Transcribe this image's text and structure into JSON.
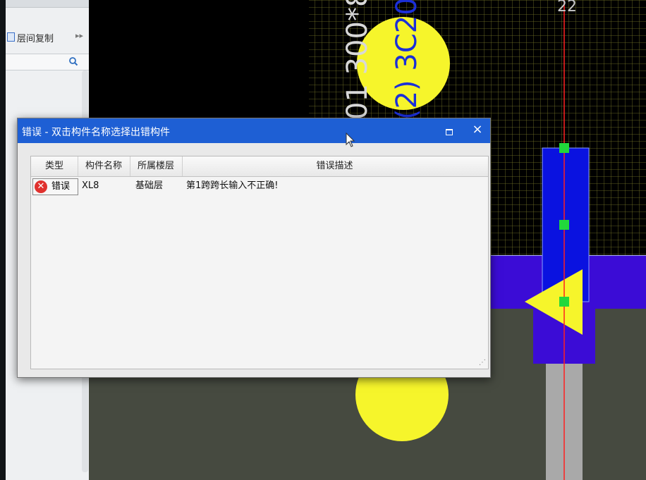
{
  "side_panel": {
    "tool_label": "层间复制",
    "more_glyph": "▸▸",
    "search_icon": "search-icon"
  },
  "drawing": {
    "axis_label": "22",
    "text_line1": "01 300*8",
    "text_line2": "(2) 3C20",
    "colors": {
      "background": "#000000",
      "grid": "#7a7a2a",
      "column": "#f6f52b",
      "beam": "#0a12e0",
      "slab": "#3b0cd6",
      "axis": "#ff2020",
      "grip": "#21d83b",
      "wall": "#464a40"
    }
  },
  "dialog": {
    "title": "错误 - 双击构件名称选择出错构件",
    "maximize_icon": "maximize-icon",
    "close_glyph": "×",
    "columns": [
      "类型",
      "构件名称",
      "所属楼层",
      "错误描述"
    ],
    "rows": [
      {
        "icon": "error-icon",
        "icon_glyph": "✕",
        "type": "错误",
        "name": "XL8",
        "floor": "基础层",
        "description": "第1跨跨长输入不正确!"
      }
    ],
    "resize_glyph": "⋰",
    "colors": {
      "titlebar": "#1e5fd4",
      "error": "#e0312e"
    }
  }
}
